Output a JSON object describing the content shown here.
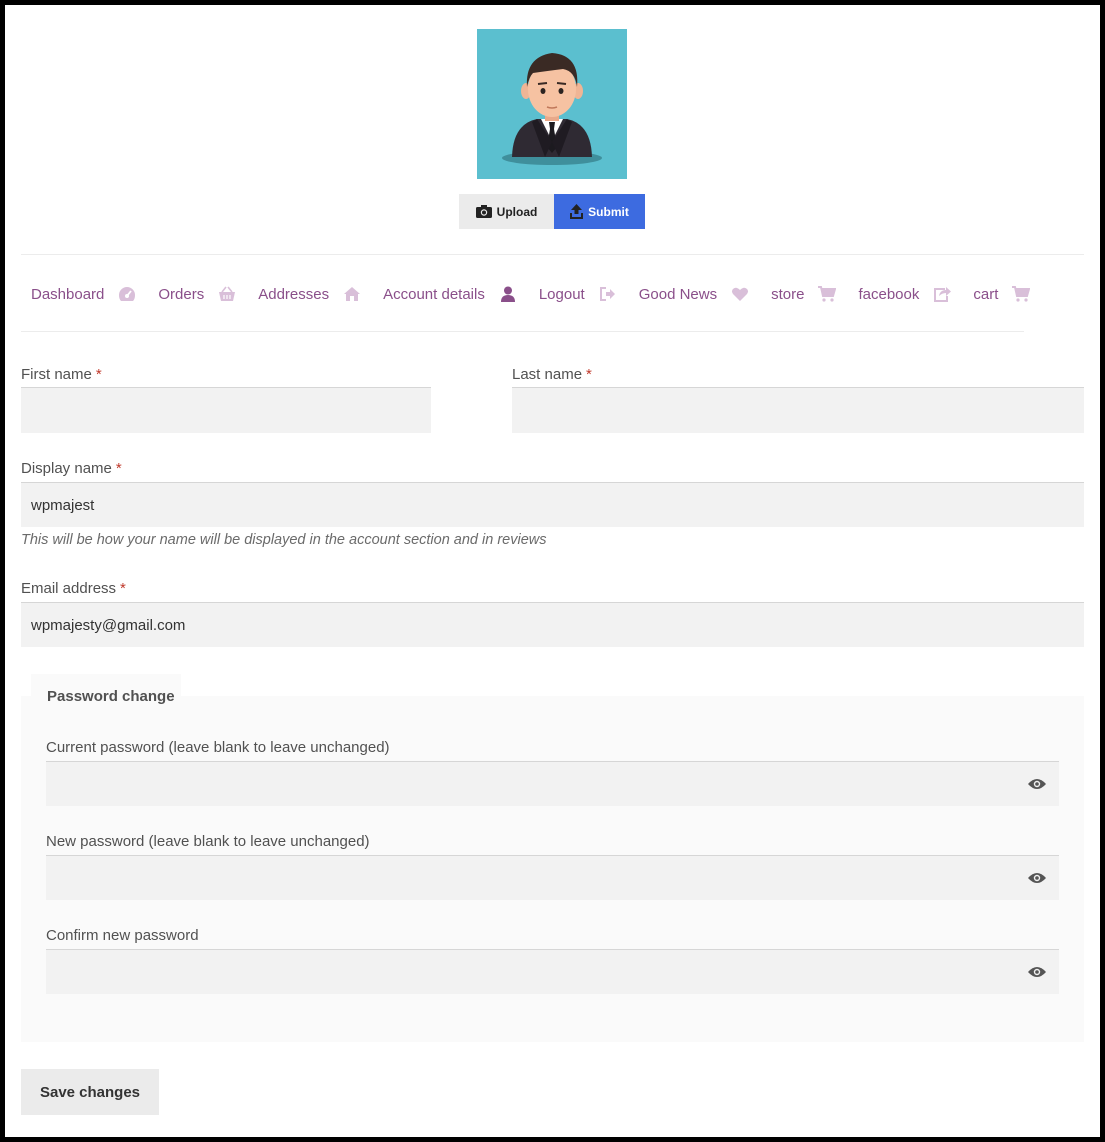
{
  "profile": {
    "upload_label": "Upload",
    "submit_label": "Submit",
    "upload_icon": "camera-icon",
    "submit_icon": "upload-icon"
  },
  "nav": [
    {
      "label": "Dashboard",
      "icon": "dashboard-icon"
    },
    {
      "label": "Orders",
      "icon": "basket-icon"
    },
    {
      "label": "Addresses",
      "icon": "home-icon"
    },
    {
      "label": "Account details",
      "icon": "user-icon"
    },
    {
      "label": "Logout",
      "icon": "sign-out-icon"
    },
    {
      "label": "Good News",
      "icon": "heart-icon"
    },
    {
      "label": "store",
      "icon": "cart-icon"
    },
    {
      "label": "facebook",
      "icon": "share-icon"
    },
    {
      "label": "cart",
      "icon": "cart-icon"
    }
  ],
  "form": {
    "first_name": {
      "label": "First name",
      "value": ""
    },
    "last_name": {
      "label": "Last name",
      "value": ""
    },
    "display_name": {
      "label": "Display name",
      "value": "wpmajest",
      "hint": "This will be how your name will be displayed in the account section and in reviews"
    },
    "email": {
      "label": "Email address",
      "value": "wpmajesty@gmail.com"
    },
    "required_mark": "*"
  },
  "password": {
    "legend": "Password change",
    "current_label": "Current password (leave blank to leave unchanged)",
    "new_label": "New password (leave blank to leave unchanged)",
    "confirm_label": "Confirm new password"
  },
  "save_label": "Save changes",
  "colors": {
    "link": "#8a4f8a",
    "accent_blue": "#3d6be0",
    "avatar_bg": "#5bbfcf",
    "required": "#c0392b"
  }
}
